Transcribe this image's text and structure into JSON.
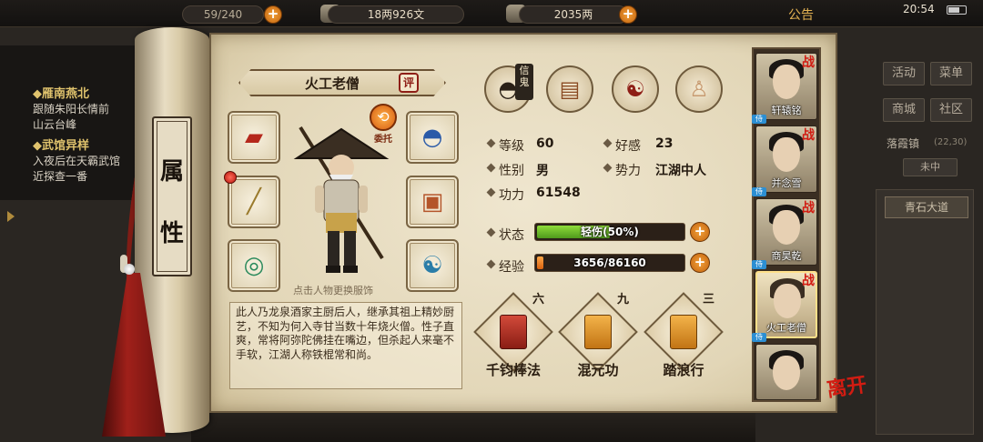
{
  "topbar": {
    "resource1": "59/240",
    "resource2": "18两926文",
    "resource3": "2035两",
    "announcement": "公告",
    "time": "20:54"
  },
  "quests": [
    {
      "title": "◆雁南燕北",
      "lines": [
        "跟随朱阳长情前",
        "山云台峰"
      ]
    },
    {
      "title": "◆武馆异样",
      "lines": [
        "入夜后在天霸武馆",
        "近探查一番"
      ]
    }
  ],
  "scroll": {
    "chars": [
      "属",
      "性"
    ]
  },
  "character": {
    "name": "火工老僧",
    "eval_badge": "评",
    "delegate_label": "委托",
    "change_hint": "点击人物更换服饰",
    "description": "此人乃龙泉酒家主厨后人，继承其祖上精妙厨艺，不知为何入寺甘当数十年烧火僧。性子直爽，常将阿弥陀佛挂在嘴边，但杀起人来毫不手软，江湖人称铁棍常和尚。"
  },
  "top_icons": [
    {
      "icon": "conical-hat-icon",
      "badge": "信鬼"
    },
    {
      "icon": "scroll-map-icon"
    },
    {
      "icon": "bagua-icon"
    },
    {
      "icon": "meridian-figure-icon"
    }
  ],
  "stats": {
    "level_label": "等级",
    "level": "60",
    "favor_label": "好感",
    "favor": "23",
    "gender_label": "性别",
    "gender": "男",
    "faction_label": "势力",
    "faction": "江湖中人",
    "power_label": "功力",
    "power": "61548",
    "status_label": "状态",
    "status_text": "轻伤(50%)",
    "status_fraction": 0.5,
    "exp_label": "经验",
    "exp_text": "3656/86160",
    "exp_fraction": 0.0424
  },
  "skills": [
    {
      "name": "千钧棒法",
      "level": "六",
      "color": "#b83025"
    },
    {
      "name": "混元功",
      "level": "九",
      "color": "#d98b1f"
    },
    {
      "name": "踏浪行",
      "level": "三",
      "color": "#d98b1f"
    }
  ],
  "party": [
    {
      "name": "轩辕铭",
      "fight": "战"
    },
    {
      "name": "并念雪",
      "fight": "战"
    },
    {
      "name": "商昊乾",
      "fight": "战"
    },
    {
      "name": "火工老僧",
      "fight": "战"
    },
    {
      "name": ""
    }
  ],
  "leave_label": "离开",
  "side_menu": {
    "activity": "活动",
    "menu": "菜单",
    "shop": "商城",
    "community": "社区",
    "town": "落霞镇",
    "town_code": "(22,30)",
    "zone": "未中",
    "location": "青石大道"
  },
  "colors": {
    "accent_red": "#d21c12",
    "status_green": "#6fbf2e",
    "exp_orange": "#e87a18",
    "plus_orange": "#e8871f"
  }
}
